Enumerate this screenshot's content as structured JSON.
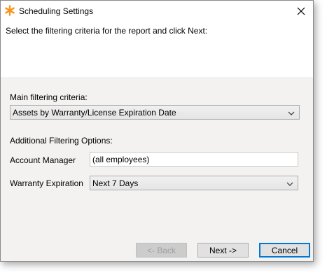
{
  "window": {
    "title": "Scheduling Settings"
  },
  "instructions": "Select the filtering criteria for the report and click Next:",
  "main_criteria": {
    "label": "Main filtering criteria:",
    "selected": "Assets by Warranty/License Expiration Date"
  },
  "additional": {
    "heading": "Additional Filtering Options:",
    "account_manager": {
      "label": "Account Manager",
      "value": "(all employees)"
    },
    "warranty_expiration": {
      "label": "Warranty Expiration",
      "selected": "Next 7 Days"
    }
  },
  "buttons": {
    "back": "<- Back",
    "next": "Next ->",
    "cancel": "Cancel"
  },
  "colors": {
    "accent": "#0078d7",
    "app_icon": "#f7941d",
    "panel": "#f3f2f1"
  }
}
